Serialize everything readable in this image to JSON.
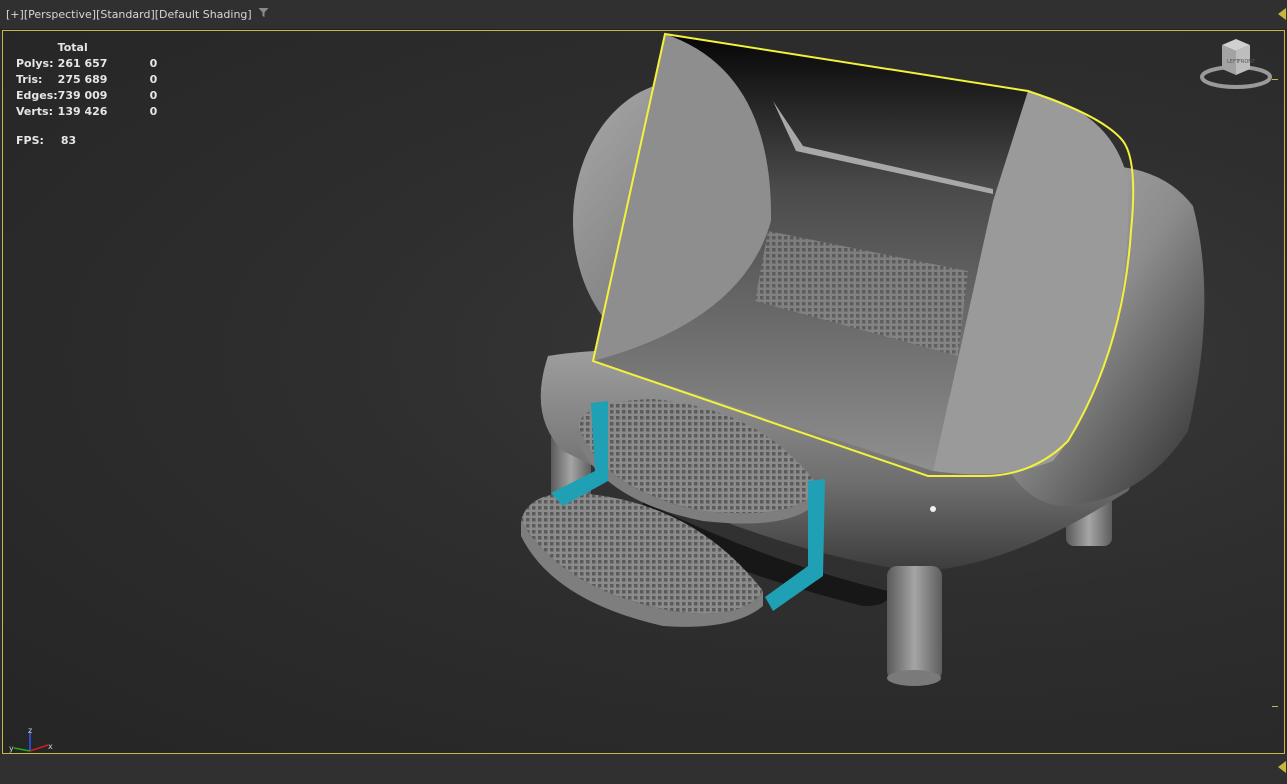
{
  "viewport_labels": {
    "plus": "[+]",
    "view": "[Perspective]",
    "mode": "[Standard]",
    "shading": "[Default Shading]",
    "filter_icon": "funnel-icon"
  },
  "stats": {
    "header": "Total",
    "rows": [
      {
        "label": "Polys:",
        "total": "261 657",
        "selected": "0"
      },
      {
        "label": "Tris:",
        "total": "275 689",
        "selected": "0"
      },
      {
        "label": "Edges:",
        "total": "739 009",
        "selected": "0"
      },
      {
        "label": "Verts:",
        "total": "139 426",
        "selected": "0"
      }
    ],
    "fps_label": "FPS:",
    "fps_value": "83"
  },
  "viewcube": {
    "icon": "viewcube-icon",
    "face_left": "LEFT",
    "face_front": "FRONT"
  },
  "axis_gizmo": {
    "x": "x",
    "y": "y",
    "z": "z"
  },
  "colors": {
    "selection_highlight": "#f2f23c",
    "viewport_border": "#c9b748",
    "step_bracket": "#1fa0b4",
    "background": "#2b2b2b"
  }
}
